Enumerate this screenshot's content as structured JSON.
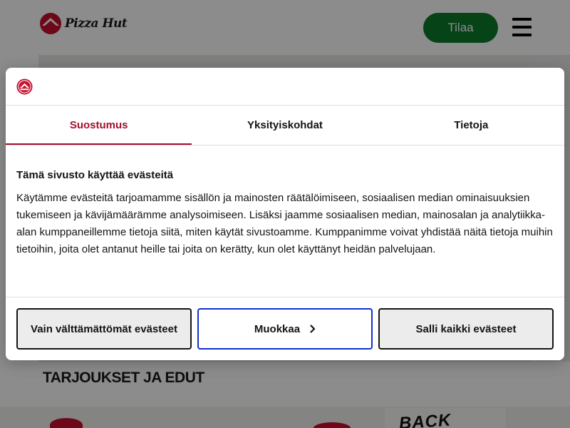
{
  "header": {
    "logo_text": "Pizza Hut",
    "order_label": "Tilaa",
    "menu_icon": "hamburger-menu-icon"
  },
  "main": {
    "section_title": "TARJOUKSET JA EDUT",
    "promo_scrawl": "BACK"
  },
  "consent": {
    "tabs": [
      {
        "label": "Suostumus",
        "active": true
      },
      {
        "label": "Yksityiskohdat",
        "active": false
      },
      {
        "label": "Tietoja",
        "active": false
      }
    ],
    "heading": "Tämä sivusto käyttää evästeitä",
    "body": "Käytämme evästeitä tarjoamamme sisällön ja mainosten räätälöimiseen, sosiaalisen median ominaisuuksien tukemiseen ja kävijämäärämme analysoimiseen. Lisäksi jaamme sosiaalisen median, mainosalan ja analytiikka-alan kumppaneillemme tietoja siitä, miten käytät sivustoamme. Kumppanimme voivat yhdistää näitä tietoja muihin tietoihin, joita olet antanut heille tai joita on kerätty, kun olet käyttänyt heidän palvelujaan.",
    "buttons": {
      "necessary": "Vain välttämättömät evästeet",
      "customize": "Muokkaa",
      "allow_all": "Salli kaikki evästeet"
    }
  },
  "colors": {
    "brand_red": "#a30f2d",
    "order_green": "#0b7a2a",
    "focus_blue": "#1032cf"
  }
}
